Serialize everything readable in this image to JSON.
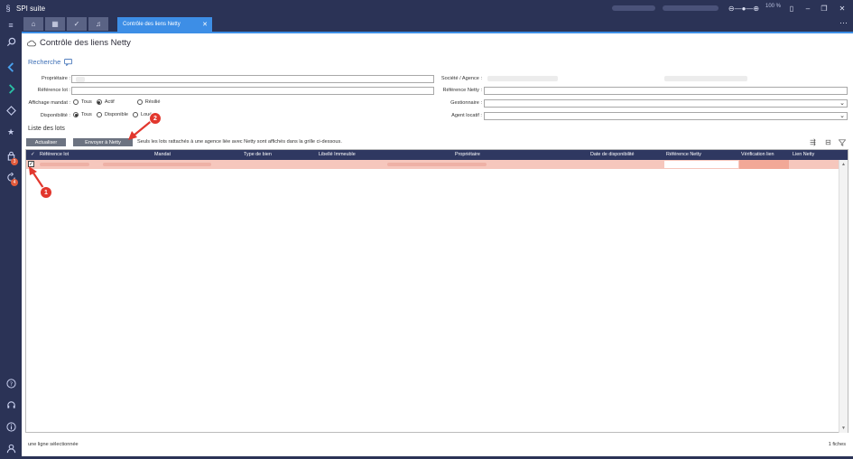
{
  "app": {
    "title": "SPI suite"
  },
  "titlebar": {
    "zoom": "100 %"
  },
  "tabs": {
    "active_label": "Contrôle des liens Netty"
  },
  "sidebar": {
    "badges": [
      "3",
      "4"
    ]
  },
  "page": {
    "title": "Contrôle des liens Netty",
    "search_section": "Recherche",
    "list_section": "Liste des lots"
  },
  "form": {
    "proprietaire_label": "Propriétaire :",
    "reference_lot_label": "Référence lot :",
    "affichage_mandat_label": "Affichage mandat :",
    "disponibilite_label": "Disponibilité :",
    "societe_agence_label": "Société / Agence :",
    "reference_netty_label": "Référence Netty :",
    "gestionnaire_label": "Gestionnaire :",
    "agent_locatif_label": "Agent locatif :",
    "mandat_options": [
      "Tous",
      "Actif",
      "Résilié"
    ],
    "mandat_selected": "Actif",
    "dispo_options": [
      "Tous",
      "Disponible",
      "Loué"
    ],
    "dispo_selected": "Tous"
  },
  "toolbar": {
    "refresh_label": "Actualiser",
    "send_label": "Envoyer à Netty",
    "note": "Seuls les lots rattachés à une agence liée avec Netty sont affichés dans la grille ci-dessous."
  },
  "grid": {
    "columns": [
      "Référence lot",
      "Mandat",
      "Type de bien",
      "Libellé Immeuble",
      "Propriétaire",
      "Date de disponibilité",
      "Référence Netty",
      "Vérification lien",
      "Lien Netty"
    ],
    "header_check": "✓",
    "row_check": "✓"
  },
  "status": {
    "left": "une ligne sélectionnée",
    "right": "1 fiches"
  },
  "annotations": [
    "1",
    "2"
  ],
  "colors": {
    "sidebar_bg": "#2b3356",
    "accent": "#3d8ee6",
    "grid_header": "#2f3861",
    "row_highlight": "#f6c7bd",
    "marker": "#e2372d"
  }
}
